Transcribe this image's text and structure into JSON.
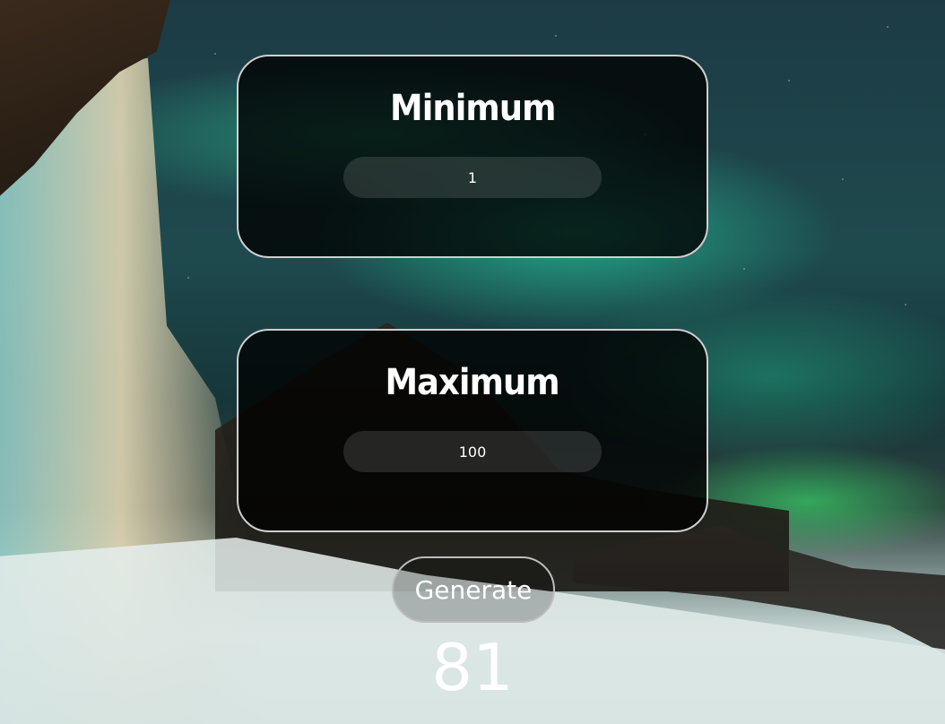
{
  "min_card": {
    "title": "Minimum",
    "input_value": "1"
  },
  "max_card": {
    "title": "Maximum",
    "input_value": "100"
  },
  "generate": {
    "label": "Generate"
  },
  "result": {
    "value": "81"
  },
  "colors": {
    "card_background": "#000000",
    "card_border": "#cfcfcf",
    "text": "#ffffff",
    "aurora": "#2ef0b4"
  }
}
